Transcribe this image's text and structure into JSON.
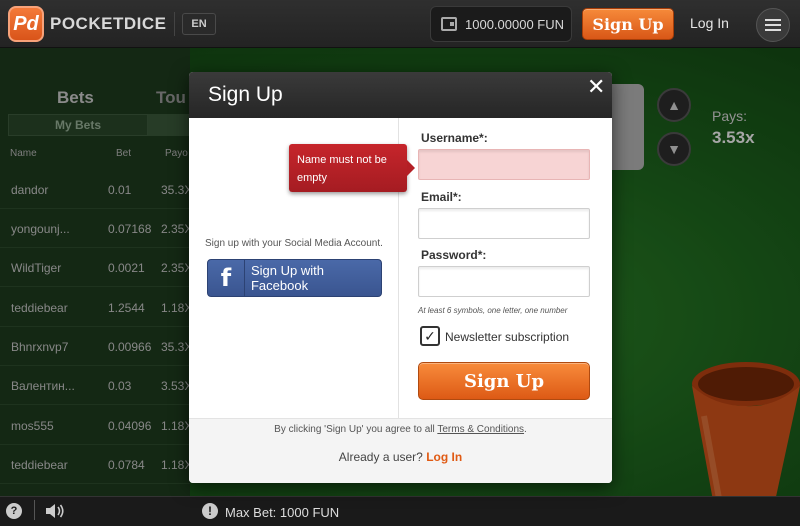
{
  "header": {
    "logo_mark": "Pd",
    "logo_text": "POCKETDICE",
    "lang": "EN",
    "balance": "1000.00000 FUN",
    "signup_label": "Sign Up",
    "login_label": "Log In"
  },
  "left_panel": {
    "tab_bets": "Bets",
    "tab_tour": "Tou",
    "subtab": "My Bets",
    "columns": [
      "Name",
      "Bet",
      "Payo"
    ],
    "rows": [
      {
        "name": "dandor",
        "bet": "0.01",
        "payout": "35.3X"
      },
      {
        "name": "yongounj...",
        "bet": "0.07168",
        "payout": "2.35X"
      },
      {
        "name": "WildTiger",
        "bet": "0.0021",
        "payout": "2.35X"
      },
      {
        "name": "teddiebear",
        "bet": "1.2544",
        "payout": "1.18X"
      },
      {
        "name": "Bhnrxnvp7",
        "bet": "0.00966",
        "payout": "35.3X"
      },
      {
        "name": "Валентин...",
        "bet": "0.03",
        "payout": "3.53X"
      },
      {
        "name": "mos555",
        "bet": "0.04096",
        "payout": "1.18X"
      },
      {
        "name": "teddiebear",
        "bet": "0.0784",
        "payout": "1.18X"
      }
    ]
  },
  "game": {
    "pays_label": "Pays:",
    "pays_value": "3.53x"
  },
  "footer": {
    "help": "?",
    "warn": "!",
    "max_bet": "Max Bet: 1000 FUN"
  },
  "modal": {
    "title": "Sign Up",
    "close": "✕",
    "social_text": "Sign up with your Social Media Account.",
    "facebook_logo": "f",
    "facebook_label": "Sign Up with Facebook",
    "username_label": "Username*:",
    "username_value": "",
    "email_label": "Email*:",
    "email_value": "",
    "password_label": "Password*:",
    "password_value": "",
    "password_hint": "At least 6 symbols, one letter, one number",
    "newsletter_label": "Newsletter subscription",
    "newsletter_checked": true,
    "checkmark": "✓",
    "submit_label": "Sign Up",
    "terms_prefix": "By clicking 'Sign Up' you agree to all ",
    "terms_link": "Terms & Conditions",
    "terms_suffix": ".",
    "already_text": "Already a user? ",
    "login_link": "Log In",
    "error_tooltip": "Name must not be empty"
  },
  "colors": {
    "accent": "#e05a13",
    "error": "#c6252b",
    "facebook": "#3b5998"
  }
}
